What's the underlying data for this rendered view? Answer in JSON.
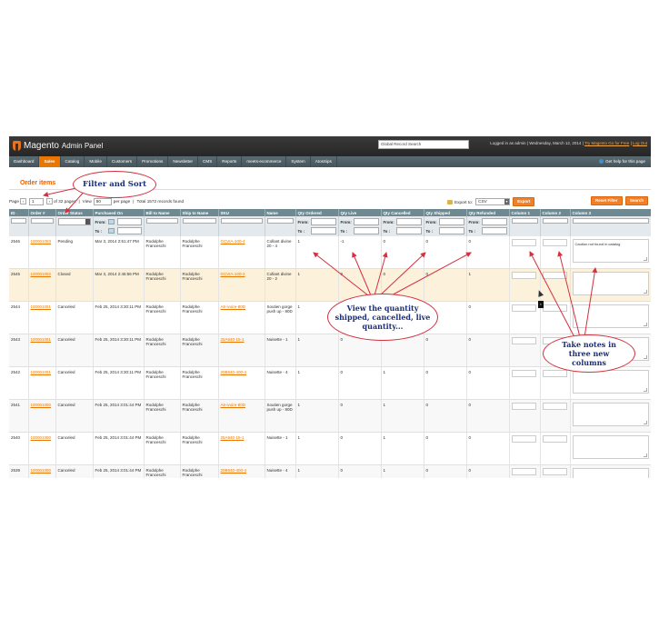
{
  "header": {
    "logo_text": "Magento",
    "logo_sub": "Admin Panel",
    "global_search_placeholder": "Global Record Search",
    "logged_in": "Logged in as admin",
    "date": "Wednesday, March 12, 2014",
    "try_link": "Try Magento Go for Free",
    "logout": "Log Out"
  },
  "nav": {
    "items": [
      "Dashboard",
      "Sales",
      "Catalog",
      "Mobile",
      "Customers",
      "Promotions",
      "Newsletter",
      "CMS",
      "Reports",
      "meets-ecommerce",
      "System",
      "AtosSips"
    ],
    "active": "Sales",
    "help": "Get help for this page"
  },
  "page": {
    "title": "Order items",
    "reset_filter": "Reset Filter",
    "search": "Search"
  },
  "pager": {
    "page_label": "Page",
    "page": "1",
    "of_pages": "of 32 pages",
    "view_label": "View",
    "per_page_value": "50",
    "per_page_label": "per page",
    "total": "Total 1572 records found"
  },
  "export": {
    "label": "Export to:",
    "format": "CSV",
    "button": "Export"
  },
  "filters": {
    "from": "From:",
    "to": "To :"
  },
  "columns": [
    "ID",
    "Order #",
    "Order Status",
    "Purchased On",
    "Bill to Name",
    "Ship to Name",
    "SKU",
    "Name",
    "Qty Ordered",
    "Qty Live",
    "Qty Cancelled",
    "Qty Shipped",
    "Qty Refunded",
    "Column 1",
    "Column 2",
    "Column 3"
  ],
  "rows": [
    {
      "id": "2546",
      "order": "100001083",
      "status": "Pending",
      "purchased": "Mar 3, 2014 2:51:47 PM",
      "bill": "Rodolphe Franceschi",
      "ship": "Rodolphe Franceschi",
      "sku": "GCVIA-100-4",
      "name": "Collant divine 20 - 4",
      "ordered": "1",
      "live": "-1",
      "cancelled": "0",
      "shipped": "0",
      "refunded": "0",
      "note": "Caution not found in catalog"
    },
    {
      "id": "2545",
      "order": "100001082",
      "status": "Closed",
      "purchased": "Mar 3, 2014 2:46:56 PM",
      "bill": "Rodolphe Franceschi",
      "ship": "Rodolphe Franceschi",
      "sku": "GCVIA-100-2",
      "name": "Collant divine 20 - 2",
      "ordered": "1",
      "live": "0",
      "cancelled": "0",
      "shipped": "0",
      "refunded": "1",
      "note": ""
    },
    {
      "id": "2544",
      "order": "100001081",
      "status": "Canceled",
      "purchased": "Feb 25, 2014 3:30:11 PM",
      "bill": "Rodolphe Franceschi",
      "ship": "Rodolphe Franceschi",
      "sku": "A6-ivoire-80D",
      "name": "Soutien gorge push up - 80D",
      "ordered": "1",
      "live": "0",
      "cancelled": "1",
      "shipped": "0",
      "refunded": "0",
      "note": ""
    },
    {
      "id": "2543",
      "order": "100001081",
      "status": "Canceled",
      "purchased": "Feb 25, 2014 3:30:11 PM",
      "bill": "Rodolphe Franceschi",
      "ship": "Rodolphe Franceschi",
      "sku": "25A940-15-1",
      "name": "Nuisette - 1",
      "ordered": "1",
      "live": "0",
      "cancelled": "1",
      "shipped": "0",
      "refunded": "0",
      "note": ""
    },
    {
      "id": "2542",
      "order": "100001081",
      "status": "Canceled",
      "purchased": "Feb 25, 2014 3:30:11 PM",
      "bill": "Rodolphe Franceschi",
      "ship": "Rodolphe Franceschi",
      "sku": "20B940-400-4",
      "name": "Nuisette - 4",
      "ordered": "1",
      "live": "0",
      "cancelled": "1",
      "shipped": "0",
      "refunded": "0",
      "note": ""
    },
    {
      "id": "2541",
      "order": "100001080",
      "status": "Canceled",
      "purchased": "Feb 25, 2014 3:01:44 PM",
      "bill": "Rodolphe Franceschi",
      "ship": "Rodolphe Franceschi",
      "sku": "A6-ivoire-80D",
      "name": "Soutien gorge push up - 80D",
      "ordered": "1",
      "live": "0",
      "cancelled": "1",
      "shipped": "0",
      "refunded": "0",
      "note": ""
    },
    {
      "id": "2540",
      "order": "100001080",
      "status": "Canceled",
      "purchased": "Feb 25, 2014 3:01:44 PM",
      "bill": "Rodolphe Franceschi",
      "ship": "Rodolphe Franceschi",
      "sku": "25A940-15-1",
      "name": "Nuisette - 1",
      "ordered": "1",
      "live": "0",
      "cancelled": "1",
      "shipped": "0",
      "refunded": "0",
      "note": ""
    },
    {
      "id": "2539",
      "order": "100001080",
      "status": "Canceled",
      "purchased": "Feb 25, 2014 3:01:44 PM",
      "bill": "Rodolphe Franceschi",
      "ship": "Rodolphe Franceschi",
      "sku": "20B940-400-4",
      "name": "Nuisette - 4",
      "ordered": "1",
      "live": "0",
      "cancelled": "1",
      "shipped": "0",
      "refunded": "0",
      "note": ""
    }
  ],
  "annotations": {
    "filter_sort": "Filter and Sort",
    "quantity": "View the quantity shipped, cancelled, live quantity...",
    "notes": "Take notes in three new columns",
    "color": "#d4303f"
  }
}
